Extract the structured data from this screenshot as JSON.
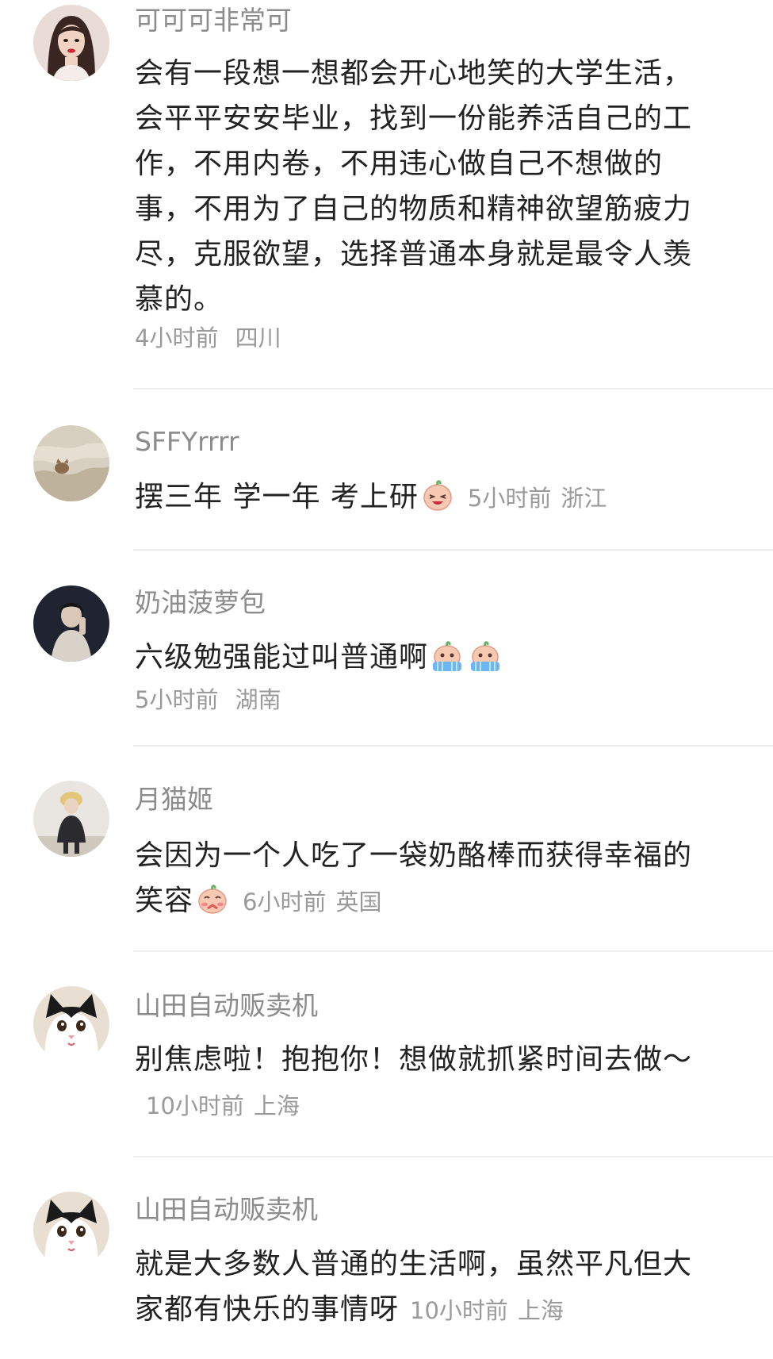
{
  "comments": [
    {
      "username": "可可可非常可",
      "text": "会有一段想一想都会开心地笑的大学生活，会平平安安毕业，找到一份能养活自己的工作，不用内卷，不用违心做自己不想做的事，不用为了自己的物质和精神欲望筋疲力尽，克服欲望，选择普通本身就是最令人羡慕的。",
      "time": "4小时前",
      "location": "四川"
    },
    {
      "username": "SFFYrrrr",
      "text": "摆三年 学一年 考上研",
      "emoji": "grin-face-emoji",
      "time": "5小时前",
      "location": "浙江"
    },
    {
      "username": "奶油菠萝包",
      "text": "六级勉强能过叫普通啊",
      "emoji": "crying-face-emoji",
      "time": "5小时前",
      "location": "湖南"
    },
    {
      "username": "月猫姬",
      "text": "会因为一个人吃了一袋奶酪棒而获得幸福的笑容",
      "emoji": "shy-face-emoji",
      "time": "6小时前",
      "location": "英国"
    },
    {
      "username": "山田自动贩卖机",
      "text": "别焦虑啦！抱抱你！想做就抓紧时间去做～",
      "time": "10小时前",
      "location": "上海"
    },
    {
      "username": "山田自动贩卖机",
      "text": "就是大多数人普通的生活啊，虽然平凡但大家都有快乐的事情呀",
      "time": "10小时前",
      "location": "上海"
    }
  ],
  "colors": {
    "username": "#8c8c8c",
    "text": "#222222",
    "meta": "#9a9a9a",
    "divider": "#ededed"
  }
}
